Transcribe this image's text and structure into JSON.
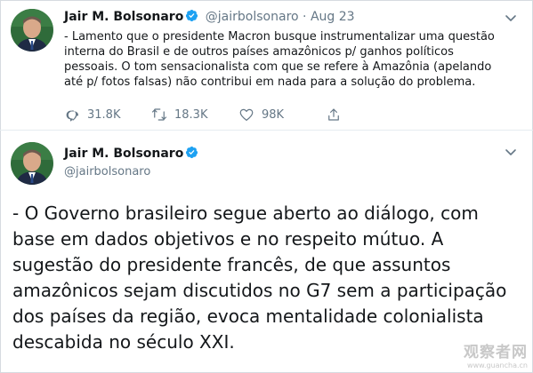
{
  "tweet1": {
    "name": "Jair M. Bolsonaro",
    "handle": "@jairbolsonaro",
    "separator": "·",
    "date": "Aug 23",
    "text_lines": [
      "- Lamento que o presidente Macron busque instrumentalizar uma questão",
      "interna do Brasil e de outros países amazônicos p/ ganhos políticos",
      "pessoais. O tom sensacionalista com que se refere à Amazônia (apelando",
      "até p/ fotos falsas) não contribui em nada para a solução do problema."
    ],
    "replies": "31.8K",
    "retweets": "18.3K",
    "likes": "98K"
  },
  "tweet2": {
    "name": "Jair M. Bolsonaro",
    "handle": "@jairbolsonaro",
    "text_lines": [
      "- O Governo brasileiro segue aberto ao diálogo, com",
      "base em dados objetivos e no respeito mútuo. A",
      "sugestão do presidente francês, de que assuntos",
      "amazônicos sejam discutidos no G7 sem a participação",
      "dos países da região, evoca mentalidade colonialista",
      "descabida no século XXI."
    ]
  },
  "watermark": {
    "title": "观察者网",
    "url": "www.guancha.cn"
  },
  "colors": {
    "text": "#14171a",
    "secondary": "#657786",
    "verified": "#1da1f2",
    "border": "#e6ecf0"
  }
}
